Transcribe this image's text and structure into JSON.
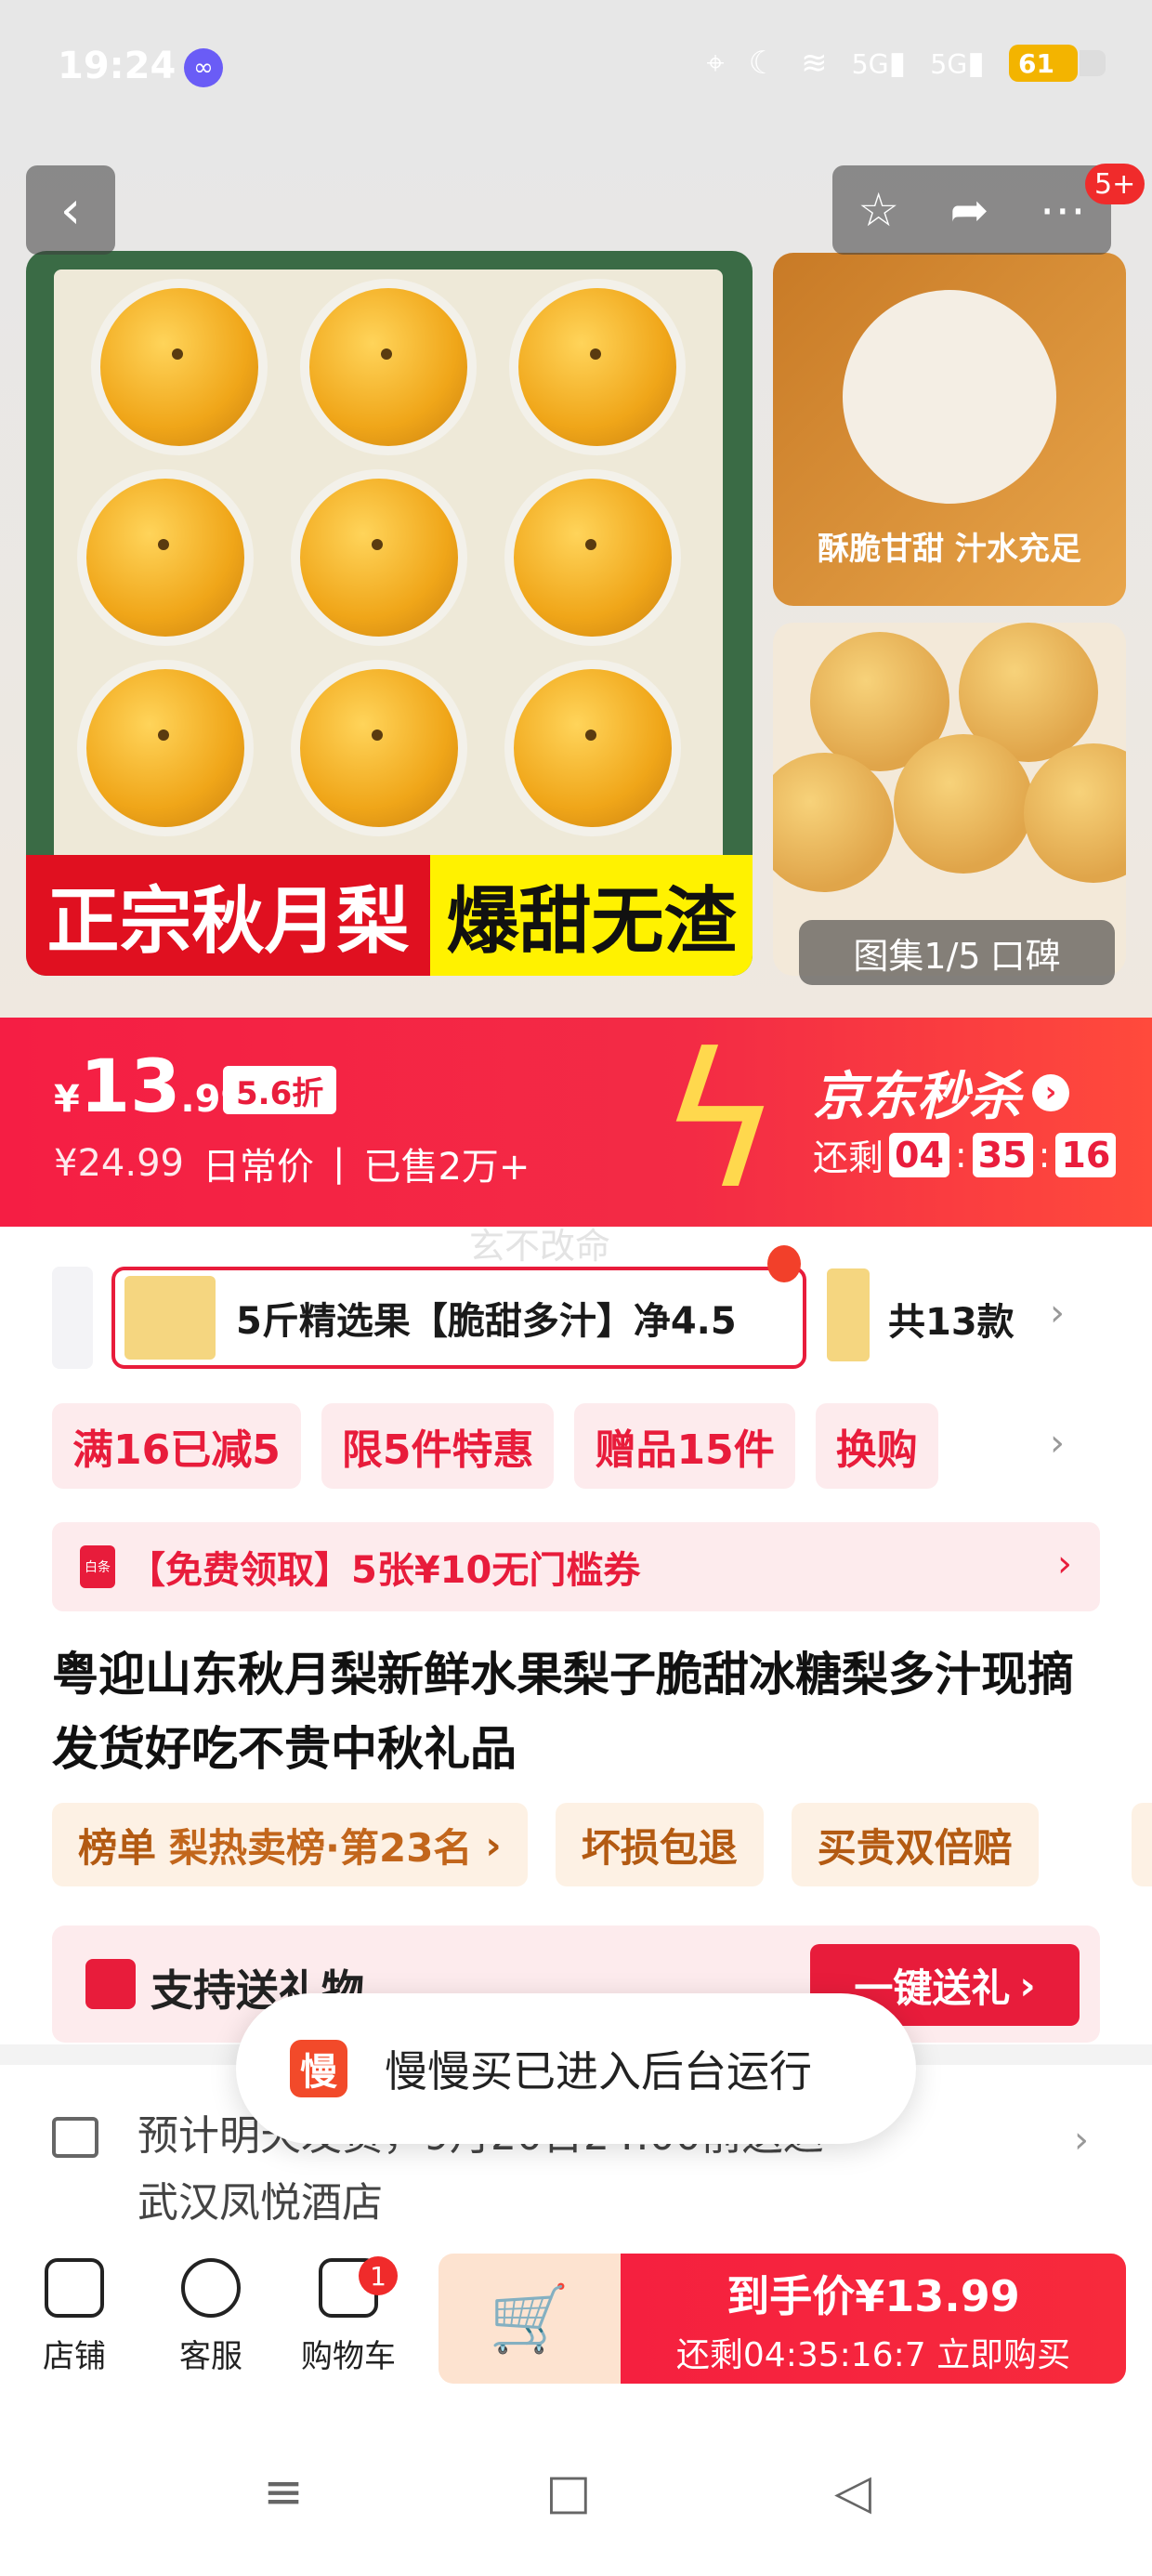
{
  "status_bar": {
    "time": "19:24",
    "app_icon": "∞",
    "network_1": "5G",
    "network_2": "5G",
    "battery": "61"
  },
  "gallery": {
    "main_banner_left": "正宗秋月梨",
    "main_banner_right": "爆甜无渣",
    "side_caption_1": "酥脆甘甜 汁水充足",
    "counter_label": "图集1/5",
    "counter_extra": "口碑",
    "message_badge": "5+"
  },
  "price_bar": {
    "currency": "¥",
    "price_int": "13",
    "price_dec": ".99",
    "discount": "5.6折",
    "original_price": "¥24.99",
    "original_label": "日常价",
    "sold": "已售2万+",
    "seckill_title": "京东秒杀",
    "countdown_label": "还剩",
    "cd_h": "04",
    "cd_m": "35",
    "cd_s": "16"
  },
  "watermark": "玄不改命",
  "sku": {
    "selected_label": "5斤精选果【脆甜多汁】净4.5",
    "count_label": "共13款"
  },
  "promos": [
    "满16已减5",
    "限5件特惠",
    "赠品15件",
    "换购"
  ],
  "coupon": {
    "icon_text": "白条",
    "text": "【免费领取】5张¥10无门槛券"
  },
  "title": "粤迎山东秋月梨新鲜水果梨子脆甜冰糖梨多汁现摘发货好吃不贵中秋礼品",
  "tags": {
    "rank_label": "榜单",
    "rank_value": "梨热卖榜·第23名",
    "tag2": "坏损包退",
    "tag3": "买贵双倍赔"
  },
  "gift": {
    "label": "支持送礼物",
    "button": "一键送礼"
  },
  "delivery": {
    "line1": "预计明天发货，9月20日24:00前送达",
    "line2": "武汉凤悦酒店"
  },
  "toast": {
    "icon": "慢",
    "text": "慢慢买已进入后台运行"
  },
  "bottom_bar": {
    "shop": "店铺",
    "service": "客服",
    "cart": "购物车",
    "cart_count": "1",
    "buy_price": "到手价¥13.99",
    "buy_sub": "还剩04:35:16:7 立即购买"
  },
  "icons": {
    "back": "back-arrow-icon",
    "star": "star-icon",
    "share": "share-icon",
    "more": "more-dots-icon",
    "truck": "truck-icon",
    "store": "store-icon",
    "service": "chat-face-icon",
    "cart": "cart-icon",
    "add_cart": "add-to-cart-icon"
  },
  "colors": {
    "accent_red": "#f32b45",
    "price_bar": "#f51e44",
    "gold_tag": "#b35a12"
  }
}
